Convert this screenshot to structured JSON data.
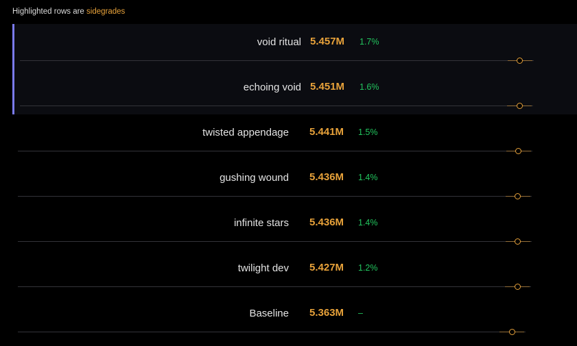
{
  "note": {
    "prefix": "Highlighted rows are ",
    "link": "sidegrades"
  },
  "colors": {
    "background": "#000000",
    "highlight_background": "#0b0c11",
    "highlight_border": "#7b7bf2",
    "value": "#e8a23a",
    "percent": "#22c55e",
    "track": "#34343a"
  },
  "rows": [
    {
      "name": "void ritual",
      "value": "5.457M",
      "percent": "1.7%",
      "highlighted": true,
      "marker_fraction": 0.963
    },
    {
      "name": "echoing void",
      "value": "5.451M",
      "percent": "1.6%",
      "highlighted": true,
      "marker_fraction": 0.962
    },
    {
      "name": "twisted appendage",
      "value": "5.441M",
      "percent": "1.5%",
      "highlighted": false,
      "marker_fraction": 0.96
    },
    {
      "name": "gushing wound",
      "value": "5.436M",
      "percent": "1.4%",
      "highlighted": false,
      "marker_fraction": 0.959
    },
    {
      "name": "infinite stars",
      "value": "5.436M",
      "percent": "1.4%",
      "highlighted": false,
      "marker_fraction": 0.959
    },
    {
      "name": "twilight dev",
      "value": "5.427M",
      "percent": "1.2%",
      "highlighted": false,
      "marker_fraction": 0.958
    },
    {
      "name": "Baseline",
      "value": "5.363M",
      "percent": "–",
      "highlighted": false,
      "marker_fraction": 0.948
    }
  ]
}
